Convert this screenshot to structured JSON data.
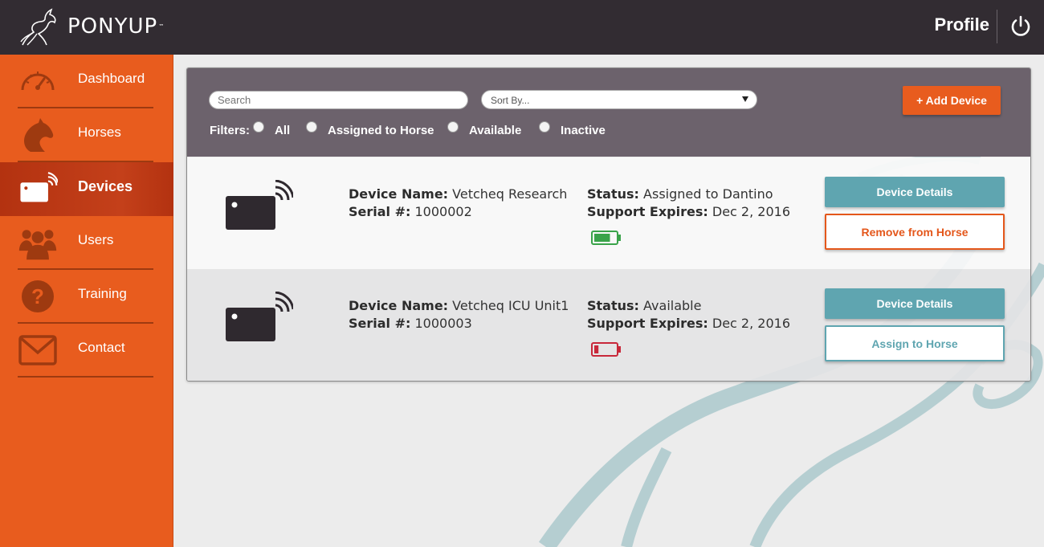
{
  "app": {
    "logo_text": "PONYUP",
    "logo_tm": "™",
    "profile_label": "Profile"
  },
  "icons": {
    "logo": "horse-logo-icon",
    "power": "power-icon",
    "dashboard": "speedometer-icon",
    "horses": "horse-head-icon",
    "devices": "device-card-icon",
    "users": "users-icon",
    "training": "question-icon",
    "contact": "envelope-icon"
  },
  "sidebar": {
    "items": [
      {
        "label": "Dashboard",
        "active": false
      },
      {
        "label": "Horses",
        "active": false
      },
      {
        "label": "Devices",
        "active": true
      },
      {
        "label": "Users",
        "active": false
      },
      {
        "label": "Training",
        "active": false
      },
      {
        "label": "Contact",
        "active": false
      }
    ]
  },
  "toolbar": {
    "search_placeholder": "Search",
    "sort_placeholder": "Sort By...",
    "add_label": "Add Device",
    "add_icon": "+",
    "filters_label": "Filters:",
    "filters": [
      "All",
      "Assigned to Horse",
      "Available",
      "Inactive"
    ]
  },
  "devices": [
    {
      "name_label": "Device Name:",
      "name": "Vetcheq Research",
      "serial_label": "Serial #:",
      "serial": "1000002",
      "status_label": "Status:",
      "status": "Assigned to Dantino",
      "support_label": "Support Expires:",
      "support": "Dec 2, 2016",
      "battery_level": 0.75,
      "battery_color": "#3aa34a",
      "details_label": "Device Details",
      "action_label": "Remove from Horse"
    },
    {
      "name_label": "Device Name:",
      "name": "Vetcheq ICU Unit1",
      "serial_label": "Serial #:",
      "serial": "1000003",
      "status_label": "Status:",
      "status": "Available",
      "support_label": "Support Expires:",
      "support": "Dec 2, 2016",
      "battery_level": 0.2,
      "battery_color": "#c8283a",
      "details_label": "Device Details",
      "action_label": "Assign to Horse"
    }
  ],
  "colors": {
    "header": "#322c32",
    "sidebar": "#e85c1e",
    "sidebar_active": "#b8360f",
    "accent_teal": "#5fa5b0",
    "accent_orange": "#e85c1e"
  }
}
